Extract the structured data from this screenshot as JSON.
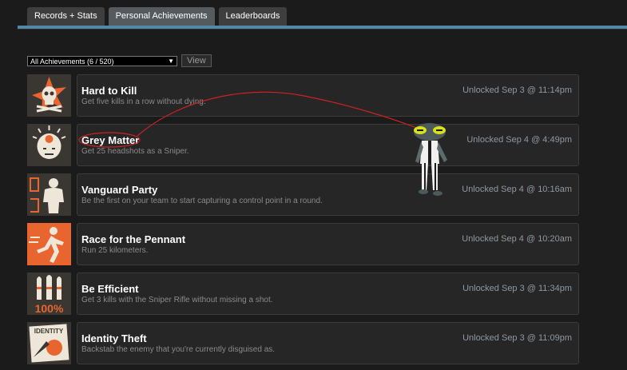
{
  "tabs": [
    {
      "label": "Records + Stats",
      "active": false
    },
    {
      "label": "Personal Achievements",
      "active": true
    },
    {
      "label": "Leaderboards",
      "active": false
    }
  ],
  "filter": {
    "selected": "All Achievements (6 / 520)",
    "view_label": "View"
  },
  "achievements": [
    {
      "title": "Hard to Kill",
      "desc": "Get five kills in a row without dying.",
      "unlocked": "Unlocked Sep 3 @ 11:14pm",
      "icon": "skull-icon"
    },
    {
      "title": "Grey Matter",
      "desc": "Get 25 headshots as a Sniper.",
      "unlocked": "Unlocked Sep 4 @ 4:49pm",
      "icon": "head-target-icon"
    },
    {
      "title": "Vanguard Party",
      "desc": "Be the first on your team to start capturing a control point in a round.",
      "unlocked": "Unlocked Sep 4 @ 10:16am",
      "icon": "vanguard-figure-icon"
    },
    {
      "title": "Race for the Pennant",
      "desc": "Run 25 kilometers.",
      "unlocked": "Unlocked Sep 4 @ 10:20am",
      "icon": "runner-icon"
    },
    {
      "title": "Be Efficient",
      "desc": "Get 3 kills with the Sniper Rifle without missing a shot.",
      "unlocked": "Unlocked Sep 3 @ 11:34pm",
      "icon": "bullets-100-icon"
    },
    {
      "title": "Identity Theft",
      "desc": "Backstab the enemy that you're currently disguised as.",
      "unlocked": "Unlocked Sep 3 @ 11:09pm",
      "icon": "identity-card-icon"
    }
  ],
  "icon_text": {
    "efficiency": "100%",
    "identity": "IDENTITY"
  },
  "colors": {
    "accent_line": "#5287a8",
    "icon_orange": "#e8652f",
    "annotation_red": "#cc2222"
  }
}
